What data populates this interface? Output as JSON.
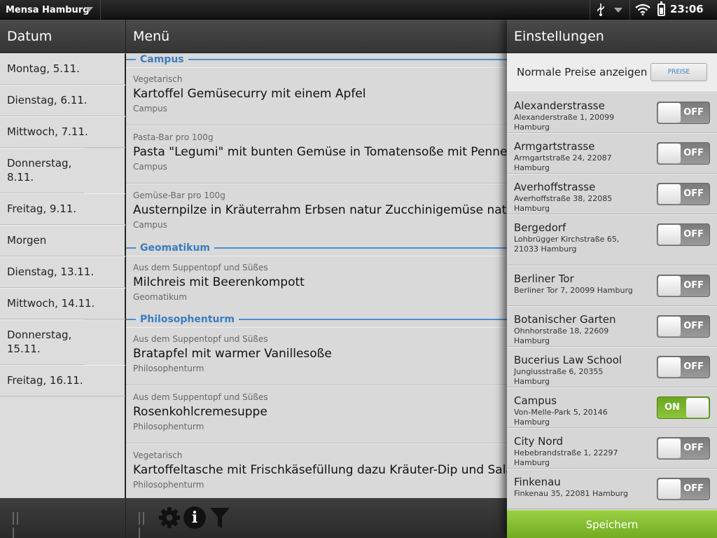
{
  "statusbar": {
    "app_title": "Mensa Hamburg",
    "clock": "23:06",
    "icons": [
      "usb-icon",
      "dropdown-arrow-icon",
      "wifi-icon",
      "battery-icon"
    ]
  },
  "date_panel": {
    "header": "Datum",
    "items": [
      "Montag, 5.11.",
      "Dienstag, 6.11.",
      "Mittwoch, 7.11.",
      "Donnerstag, 8.11.",
      "Freitag, 9.11.",
      "Morgen",
      "Dienstag, 13.11.",
      "Mittwoch, 14.11.",
      "Donnerstag, 15.11.",
      "Freitag, 16.11."
    ]
  },
  "menu_panel": {
    "header": "Menü",
    "sections": [
      {
        "name": "Campus",
        "meals": [
          {
            "category": "Vegetarisch",
            "title": "Kartoffel Gemüsecurry mit einem Apfel",
            "location": "Campus"
          },
          {
            "category": "Pasta-Bar pro 100g",
            "title": "Pasta \"Legumi\" mit bunten Gemüse in Tomatensoße mit Penne",
            "location": "Campus"
          },
          {
            "category": "Gemüse-Bar pro 100g",
            "title": "Austernpilze in Kräuterrahm Erbsen natur Zucchinigemüse natur Zw",
            "location": "Campus"
          }
        ]
      },
      {
        "name": "Geomatikum",
        "meals": [
          {
            "category": "Aus dem Suppentopf und Süßes",
            "title": "Milchreis mit Beerenkompott",
            "location": "Geomatikum"
          }
        ]
      },
      {
        "name": "Philosophenturm",
        "meals": [
          {
            "category": "Aus dem Suppentopf und Süßes",
            "title": "Bratapfel mit warmer Vanillesoße",
            "location": "Philosophenturm"
          },
          {
            "category": "Aus dem Suppentopf und Süßes",
            "title": "Rosenkohlcremesuppe",
            "location": "Philosophenturm"
          },
          {
            "category": "Vegetarisch",
            "title": "Kartoffeltasche mit Frischkäsefüllung dazu Kräuter-Dip und Salatgarn",
            "location": "Philosophenturm"
          }
        ]
      }
    ],
    "footer_icons": [
      "drag-handle-icon",
      "gear-icon",
      "info-icon",
      "filter-icon"
    ]
  },
  "settings_panel": {
    "header": "Einstellungen",
    "prices_label": "Normale Preise anzeigen",
    "prices_button": "PREISE",
    "mensen": [
      {
        "name": "Alexanderstrasse",
        "address": "Alexanderstraße 1, 20099 Hamburg",
        "state": "OFF"
      },
      {
        "name": "Armgartstrasse",
        "address": "Armgartstraße 24, 22087 Hamburg",
        "state": "OFF"
      },
      {
        "name": "Averhoffstrasse",
        "address": "Averhoffstraße 38, 22085 Hamburg",
        "state": "OFF"
      },
      {
        "name": "Bergedorf",
        "address": "Lohbrügger Kirchstraße 65, 21033 Hamburg",
        "state": "OFF"
      },
      {
        "name": "Berliner Tor",
        "address": "Berliner Tor 7, 20099 Hamburg",
        "state": "OFF"
      },
      {
        "name": "Botanischer Garten",
        "address": "Ohnhorstraße 18, 22609 Hamburg",
        "state": "OFF"
      },
      {
        "name": "Bucerius Law School",
        "address": "Jungiusstraße 6, 20355 Hamburg",
        "state": "OFF"
      },
      {
        "name": "Campus",
        "address": "Von-Melle-Park 5, 20146 Hamburg",
        "state": "ON"
      },
      {
        "name": "City Nord",
        "address": "Hebebrandstraße 1, 22297 Hamburg",
        "state": "OFF"
      },
      {
        "name": "Finkenau",
        "address": "Finkenau 35, 22081 Hamburg",
        "state": "OFF"
      }
    ],
    "save_label": "Speichern"
  },
  "colors": {
    "accent_blue": "#3a7cc0",
    "toggle_on_green": "#8cc53b",
    "save_green": "#85bf30"
  }
}
